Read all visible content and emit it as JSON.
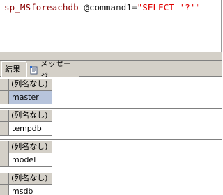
{
  "editor": {
    "code": {
      "proc": "sp_MSforeachdb",
      "param": " @command1",
      "op": "=",
      "str": "\"SELECT '?'\""
    }
  },
  "tabs": [
    {
      "label": "結果",
      "icon": "grid-icon"
    },
    {
      "label": "メッセージ",
      "icon": "message-icon"
    }
  ],
  "results": [
    {
      "column": "(列名なし)",
      "value": "master",
      "selected": true
    },
    {
      "column": "(列名なし)",
      "value": "tempdb",
      "selected": false
    },
    {
      "column": "(列名なし)",
      "value": "model",
      "selected": false
    },
    {
      "column": "(列名なし)",
      "value": "msdb",
      "selected": false
    }
  ]
}
